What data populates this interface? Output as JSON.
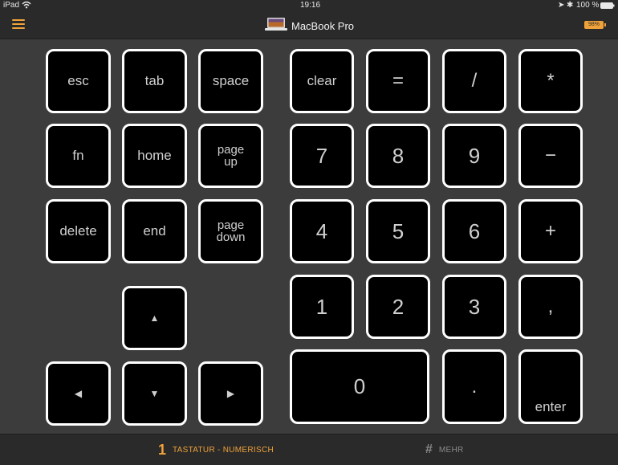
{
  "status_bar": {
    "device": "iPad",
    "time": "19:16",
    "battery_percent": "100 %"
  },
  "nav": {
    "title": "MacBook Pro",
    "battery_badge": "98%",
    "accent_color": "#f0a23a",
    "menu_icon": "hamburger-menu-icon",
    "device_icon": "laptop-icon"
  },
  "keys": {
    "esc": "esc",
    "tab": "tab",
    "space": "space",
    "clear": "clear",
    "equals": "=",
    "divide": "/",
    "multiply": "*",
    "fn": "fn",
    "home": "home",
    "page_up": [
      "page",
      "up"
    ],
    "seven": "7",
    "eight": "8",
    "nine": "9",
    "minus": "−",
    "delete": "delete",
    "end": "end",
    "page_down": [
      "page",
      "down"
    ],
    "four": "4",
    "five": "5",
    "six": "6",
    "plus": "+",
    "up": "▲",
    "one": "1",
    "two": "2",
    "three": "3",
    "comma": ",",
    "left": "◀",
    "down": "▼",
    "right": "▶",
    "zero": "0",
    "period": ".",
    "enter": "enter"
  },
  "tabs": [
    {
      "icon": "1",
      "label": "TASTATUR - NUMERISCH",
      "active": true
    },
    {
      "icon": "#",
      "label": "MEHR",
      "active": false
    }
  ]
}
